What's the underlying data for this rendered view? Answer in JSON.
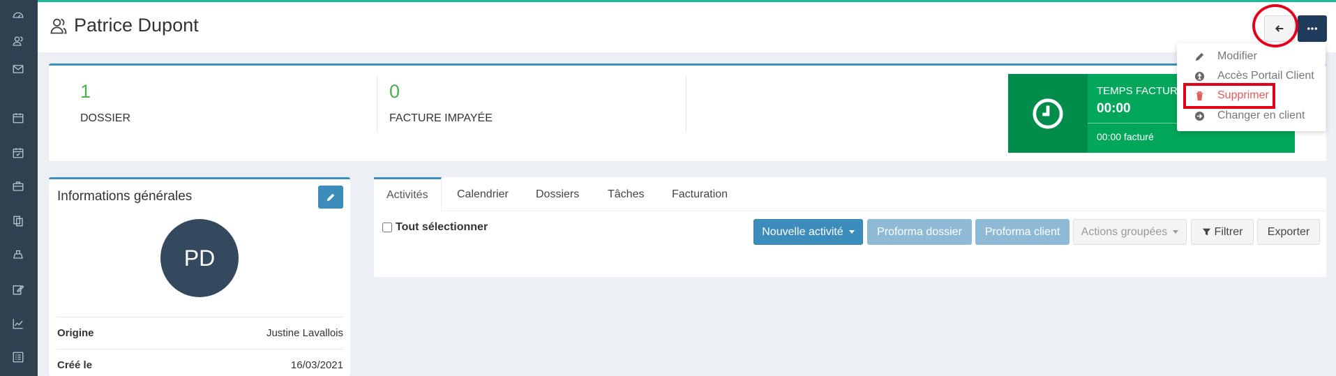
{
  "header": {
    "title": "Patrice Dupont"
  },
  "actions_menu": {
    "items": [
      {
        "label": "Modifier",
        "icon": "pencil-icon"
      },
      {
        "label": "Accès Portail Client",
        "icon": "user-circle-icon"
      },
      {
        "label": "Supprimer",
        "icon": "trash-icon"
      },
      {
        "label": "Changer en client",
        "icon": "arrow-circle-right-icon"
      }
    ]
  },
  "stats": {
    "dossier": {
      "value": "1",
      "label": "DOSSIER"
    },
    "facture": {
      "value": "0",
      "label": "FACTURE IMPAYÉE"
    },
    "time": {
      "title": "TEMPS FACTUR",
      "value": "00:00",
      "sub": "00:00 facturé"
    }
  },
  "info": {
    "title": "Informations générales",
    "initials": "PD",
    "rows": [
      {
        "key": "Origine",
        "value": "Justine Lavallois"
      },
      {
        "key": "Créé le",
        "value": "16/03/2021"
      }
    ]
  },
  "tabs": [
    {
      "label": "Activités",
      "active": true
    },
    {
      "label": "Calendrier"
    },
    {
      "label": "Dossiers"
    },
    {
      "label": "Tâches"
    },
    {
      "label": "Facturation"
    }
  ],
  "toolbar": {
    "select_all": "Tout sélectionner",
    "new_activity": "Nouvelle activité",
    "proforma_dossier": "Proforma dossier",
    "proforma_client": "Proforma client",
    "grouped_actions": "Actions groupées",
    "filter": "Filtrer",
    "export": "Exporter"
  },
  "colors": {
    "sidebar": "#2f4050",
    "accent": "#3c8dbc",
    "success": "#00a65a",
    "danger": "#e15b5b",
    "dark_button": "#1f3a5a",
    "top_line": "#1abc9c"
  }
}
